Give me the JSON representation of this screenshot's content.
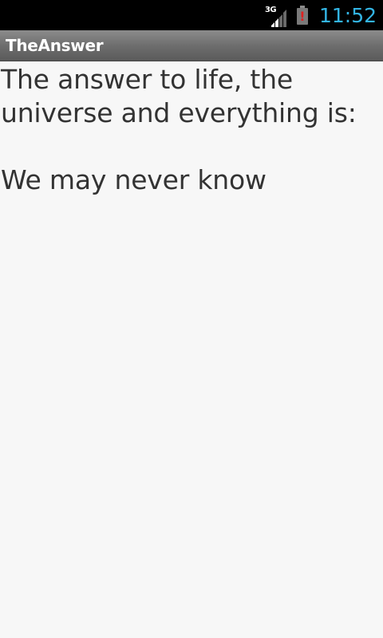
{
  "status_bar": {
    "network_type": "3G",
    "signal_icon": "signal-bars-icon",
    "battery_icon": "battery-alert-icon",
    "battery_alert_symbol": "!",
    "time": "11:52",
    "clock_color": "#33b5e5"
  },
  "title_bar": {
    "app_title": "TheAnswer"
  },
  "content": {
    "text": "The answer to life, the\nuniverse and everything is:\n\nWe may never know"
  }
}
